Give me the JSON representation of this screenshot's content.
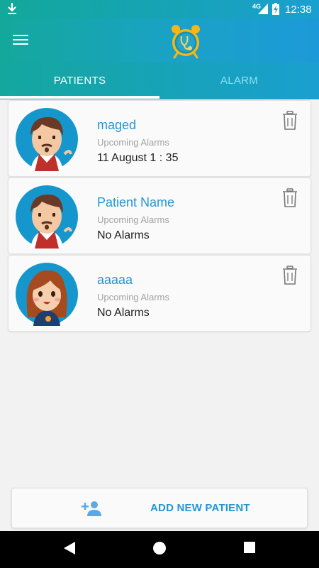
{
  "status": {
    "network": "4G",
    "time": "12:38",
    "icons": [
      "download-icon",
      "signal-icon",
      "battery-charging-icon"
    ]
  },
  "app_bar": {
    "menu_icon": "hamburger-icon",
    "logo_icon": "alarm-clock-stethoscope-logo"
  },
  "tabs": [
    {
      "label": "PATIENTS",
      "active": true
    },
    {
      "label": "ALARM",
      "active": false
    }
  ],
  "patients": [
    {
      "name": "maged",
      "subtitle": "Upcoming Alarms",
      "alarm": "11 August 1 : 35",
      "avatar": "male-avatar"
    },
    {
      "name": "Patient Name",
      "subtitle": "Upcoming Alarms",
      "alarm": "No Alarms",
      "avatar": "male-avatar"
    },
    {
      "name": "aaaaa",
      "subtitle": "Upcoming Alarms",
      "alarm": "No Alarms",
      "avatar": "female-avatar"
    }
  ],
  "add_button": {
    "label": "ADD NEW PATIENT",
    "icon": "add-person-icon"
  },
  "colors": {
    "accent": "#2196d8",
    "teal": "#14a89b",
    "blue": "#1c9ad8"
  },
  "nav": [
    "back-icon",
    "home-icon",
    "recents-icon"
  ]
}
